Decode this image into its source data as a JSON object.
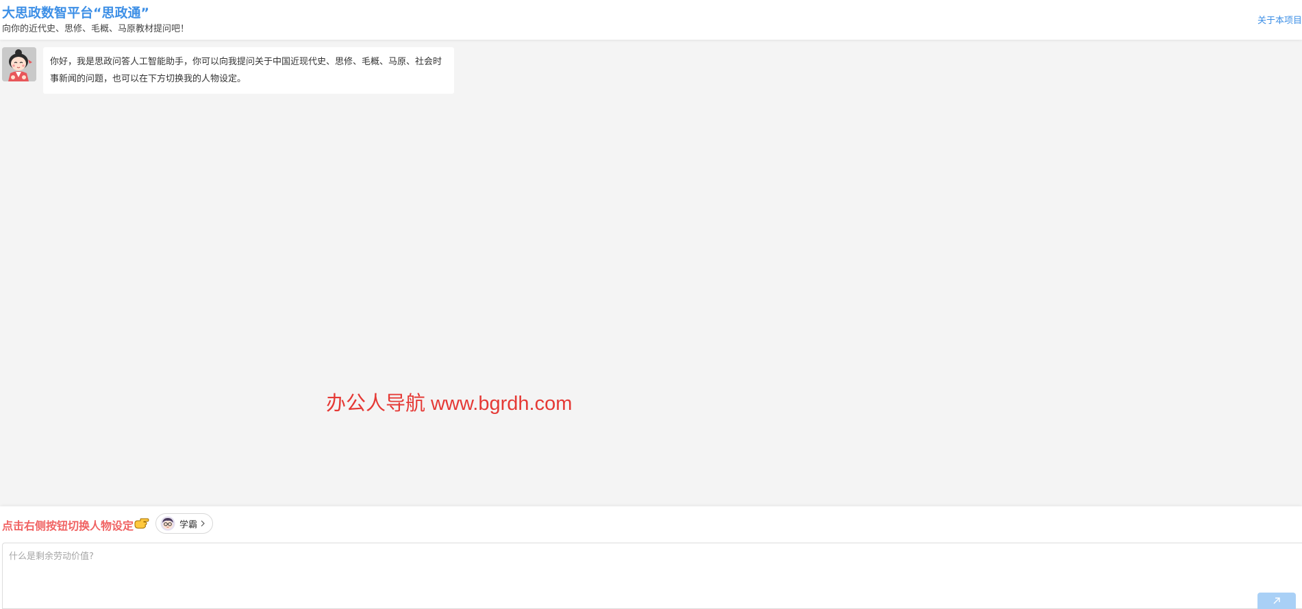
{
  "header": {
    "title": "大思政数智平台“思政通”",
    "subtitle": "向你的近代史、思修、毛概、马原教材提问吧！",
    "about_link": "关于本项目"
  },
  "chat": {
    "messages": [
      {
        "role": "assistant",
        "avatar_icon": "monk-girl-avatar",
        "text": "你好，我是思政问答人工智能助手，你可以向我提问关于中国近现代史、思修、毛概、马原、社会时事新闻的问题，也可以在下方切换我的人物设定。"
      }
    ]
  },
  "watermark": "办公人导航 www.bgrdh.com",
  "input_panel": {
    "switch_hint": "点击右侧按钮切换人物设定",
    "hint_icon": "pointing-hand-icon",
    "persona": {
      "label": "学霸",
      "icon": "nerd-avatar-icon"
    },
    "question_placeholder": "什么是剩余劳动价值?",
    "question_value": "",
    "send_icon": "send-arrow-icon"
  },
  "colors": {
    "accent": "#3d8fe6",
    "hint_red": "#f06262",
    "watermark_red": "#e53935",
    "send_button": "#a9d0f6",
    "background": "#f4f4f4"
  }
}
